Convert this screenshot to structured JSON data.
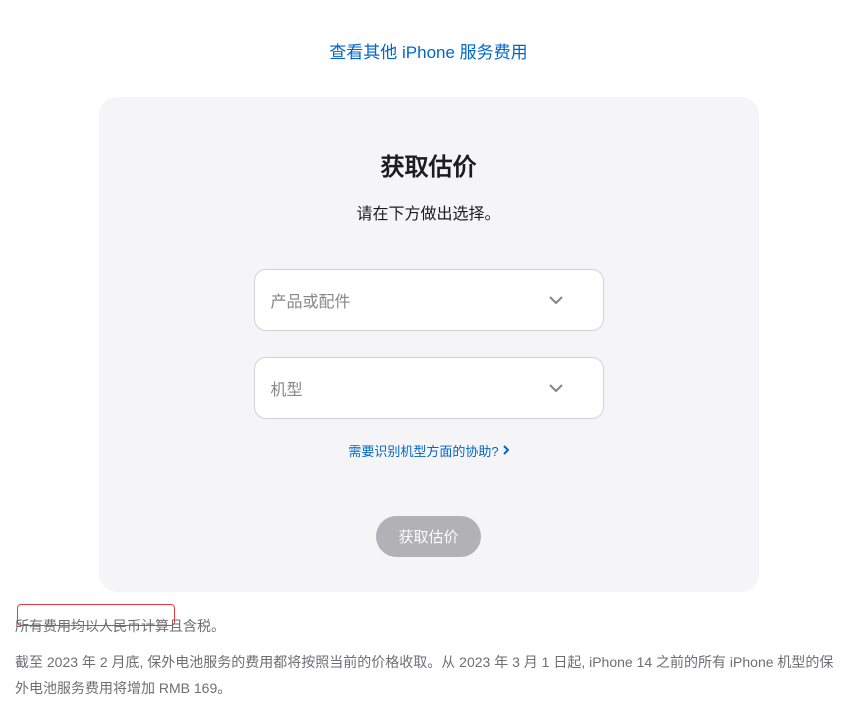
{
  "topLink": {
    "label": "查看其他 iPhone 服务费用"
  },
  "card": {
    "title": "获取估价",
    "subtitle": "请在下方做出选择。",
    "select1": {
      "placeholder": "产品或配件"
    },
    "select2": {
      "placeholder": "机型"
    },
    "helpLink": {
      "label": "需要识别机型方面的协助?"
    },
    "submit": {
      "label": "获取估价"
    }
  },
  "footer": {
    "line1": "所有费用均以人民币计算且含税。",
    "line2": "截至 2023 年 2 月底, 保外电池服务的费用都将按照当前的价格收取。从 2023 年 3 月 1 日起, iPhone 14 之前的所有 iPhone 机型的保外电池服务费用将增加 RMB 169。"
  }
}
